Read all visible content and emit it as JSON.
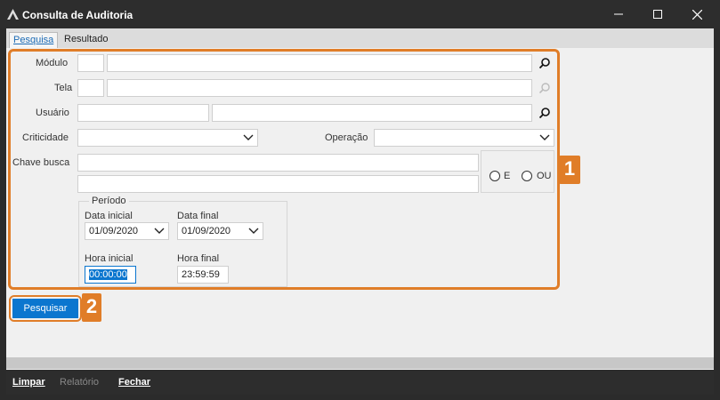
{
  "window": {
    "title": "Consulta de Auditoria"
  },
  "tabs": [
    {
      "label": "Pesquisa"
    },
    {
      "label": "Resultado"
    }
  ],
  "form": {
    "modulo_label": "Módulo",
    "tela_label": "Tela",
    "usuario_label": "Usuário",
    "criticidade_label": "Criticidade",
    "operacao_label": "Operação",
    "chave_busca_label": "Chave busca",
    "radio_e": "E",
    "radio_ou": "OU",
    "periodo_label": "Período",
    "data_inicial_label": "Data inicial",
    "data_final_label": "Data final",
    "data_inicial_value": "01/09/2020",
    "data_final_value": "01/09/2020",
    "hora_inicial_label": "Hora inicial",
    "hora_final_label": "Hora final",
    "hora_inicial_value": "00:00:00",
    "hora_final_value": "23:59:59"
  },
  "callouts": {
    "one": "1",
    "two": "2"
  },
  "actions": {
    "pesquisar": "Pesquisar"
  },
  "bottom": {
    "limpar": "Limpar",
    "relatorio": "Relatório",
    "fechar": "Fechar"
  },
  "colors": {
    "accent_orange": "#e07d28",
    "primary_blue": "#0b76cf",
    "titlebar": "#2d2d2d"
  }
}
